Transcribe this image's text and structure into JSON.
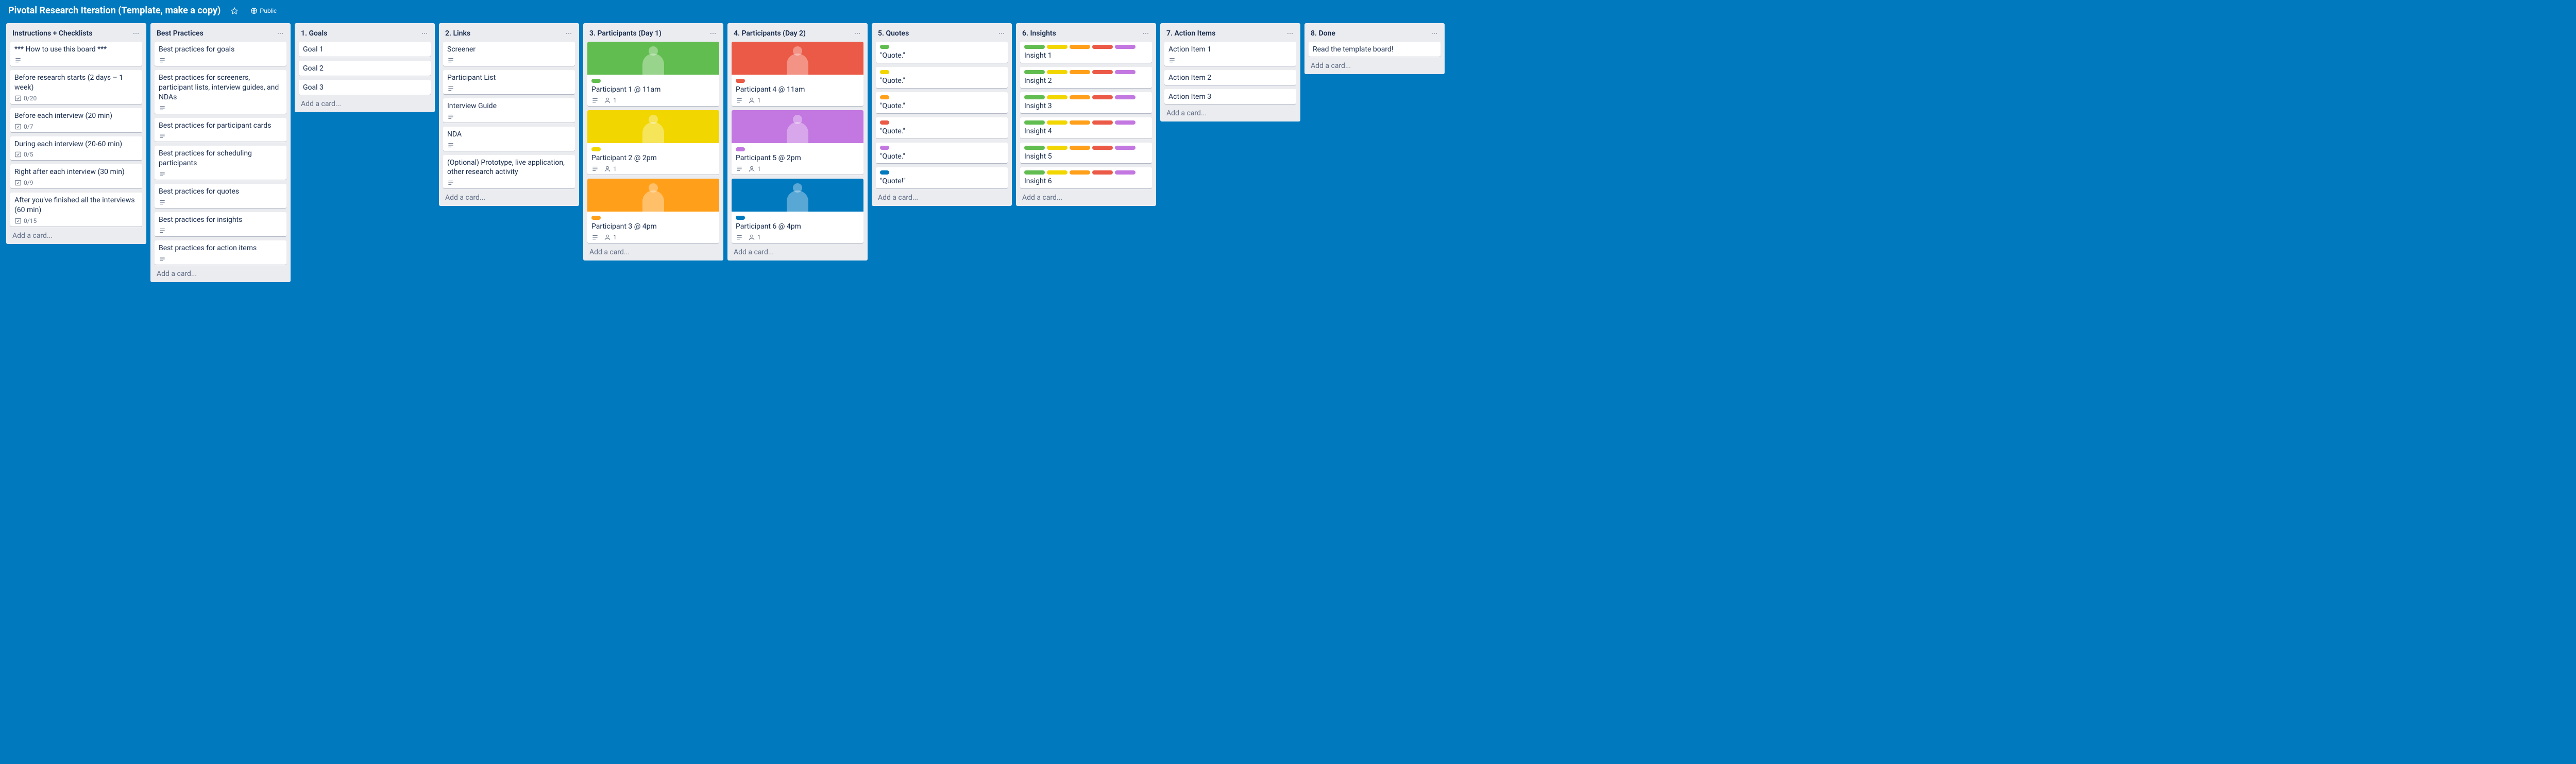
{
  "header": {
    "title": "Pivotal Research Iteration (Template, make a copy)",
    "visibility": "Public"
  },
  "add_card_label": "Add a card...",
  "lists": [
    {
      "title": "Instructions + Checklists",
      "cards": [
        {
          "title": "*** How to use this board ***",
          "desc": true
        },
        {
          "title": "Before research starts (2 days – 1 week)",
          "checklist": "0/20"
        },
        {
          "title": "Before each interview (20 min)",
          "checklist": "0/7"
        },
        {
          "title": "During each interview (20-60 min)",
          "checklist": "0/5"
        },
        {
          "title": "Right after each interview (30 min)",
          "checklist": "0/9"
        },
        {
          "title": "After you've finished all the interviews (60 min)",
          "checklist": "0/15"
        }
      ]
    },
    {
      "title": "Best Practices",
      "cards": [
        {
          "title": "Best practices for goals",
          "desc": true
        },
        {
          "title": "Best practices for screeners, participant lists, interview guides, and NDAs",
          "desc": true
        },
        {
          "title": "Best practices for participant cards",
          "desc": true
        },
        {
          "title": "Best practices for scheduling participants",
          "desc": true
        },
        {
          "title": "Best practices for quotes",
          "desc": true
        },
        {
          "title": "Best practices for insights",
          "desc": true
        },
        {
          "title": "Best practices for action items",
          "desc": true
        }
      ]
    },
    {
      "title": "1. Goals",
      "cards": [
        {
          "title": "Goal 1"
        },
        {
          "title": "Goal 2"
        },
        {
          "title": "Goal 3"
        }
      ]
    },
    {
      "title": "2. Links",
      "cards": [
        {
          "title": "Screener",
          "desc": true
        },
        {
          "title": "Participant List",
          "desc": true
        },
        {
          "title": "Interview Guide",
          "desc": true
        },
        {
          "title": "NDA",
          "desc": true
        },
        {
          "title": "(Optional) Prototype, live application, other research activity",
          "desc": true
        }
      ]
    },
    {
      "title": "3. Participants (Day 1)",
      "cards": [
        {
          "cover": "#61bd4f",
          "labels": [
            "green"
          ],
          "title": "Participant 1 @ 11am",
          "desc": true,
          "members": 1
        },
        {
          "cover": "#f2d600",
          "labels": [
            "yellow"
          ],
          "title": "Participant 2 @ 2pm",
          "desc": true,
          "members": 1
        },
        {
          "cover": "#ff9f1a",
          "labels": [
            "orange"
          ],
          "title": "Participant 3 @ 4pm",
          "desc": true,
          "members": 1
        }
      ]
    },
    {
      "title": "4. Participants (Day 2)",
      "cards": [
        {
          "cover": "#eb5a46",
          "labels": [
            "red"
          ],
          "title": "Participant 4 @ 11am",
          "desc": true,
          "members": 1
        },
        {
          "cover": "#c377e0",
          "labels": [
            "purple"
          ],
          "title": "Participant 5 @ 2pm",
          "desc": true,
          "members": 1
        },
        {
          "cover": "#0079bf",
          "labels": [
            "blue"
          ],
          "title": "Participant 6 @ 4pm",
          "desc": true,
          "members": 1
        }
      ]
    },
    {
      "title": "5. Quotes",
      "cards": [
        {
          "labels": [
            "green"
          ],
          "title": "\"Quote.\""
        },
        {
          "labels": [
            "yellow"
          ],
          "title": "\"Quote.\""
        },
        {
          "labels": [
            "orange"
          ],
          "title": "\"Quote.\""
        },
        {
          "labels": [
            "red"
          ],
          "title": "\"Quote.\""
        },
        {
          "labels": [
            "purple"
          ],
          "title": "\"Quote.\""
        },
        {
          "labels": [
            "blue"
          ],
          "title": "\"Quote!\""
        }
      ]
    },
    {
      "title": "6. Insights",
      "cards": [
        {
          "labels": [
            "green",
            "yellow",
            "orange",
            "red",
            "purple"
          ],
          "title": "Insight 1"
        },
        {
          "labels": [
            "green",
            "yellow",
            "orange",
            "red",
            "purple"
          ],
          "title": "Insight 2"
        },
        {
          "labels": [
            "green",
            "yellow",
            "orange",
            "red",
            "purple"
          ],
          "title": "Insight 3"
        },
        {
          "labels": [
            "green",
            "yellow",
            "orange",
            "red",
            "purple"
          ],
          "title": "Insight 4"
        },
        {
          "labels": [
            "green",
            "yellow",
            "orange",
            "red",
            "purple"
          ],
          "title": "Insight 5"
        },
        {
          "labels": [
            "green",
            "yellow",
            "orange",
            "red",
            "purple"
          ],
          "title": "Insight 6"
        }
      ]
    },
    {
      "title": "7. Action Items",
      "cards": [
        {
          "title": "Action Item 1",
          "desc": true
        },
        {
          "title": "Action Item 2"
        },
        {
          "title": "Action Item 3"
        }
      ]
    },
    {
      "title": "8. Done",
      "cards": [
        {
          "title": "Read the template board!"
        }
      ]
    }
  ],
  "label_colors": {
    "green": "#61bd4f",
    "yellow": "#f2d600",
    "orange": "#ff9f1a",
    "red": "#eb5a46",
    "purple": "#c377e0",
    "blue": "#0079bf"
  }
}
